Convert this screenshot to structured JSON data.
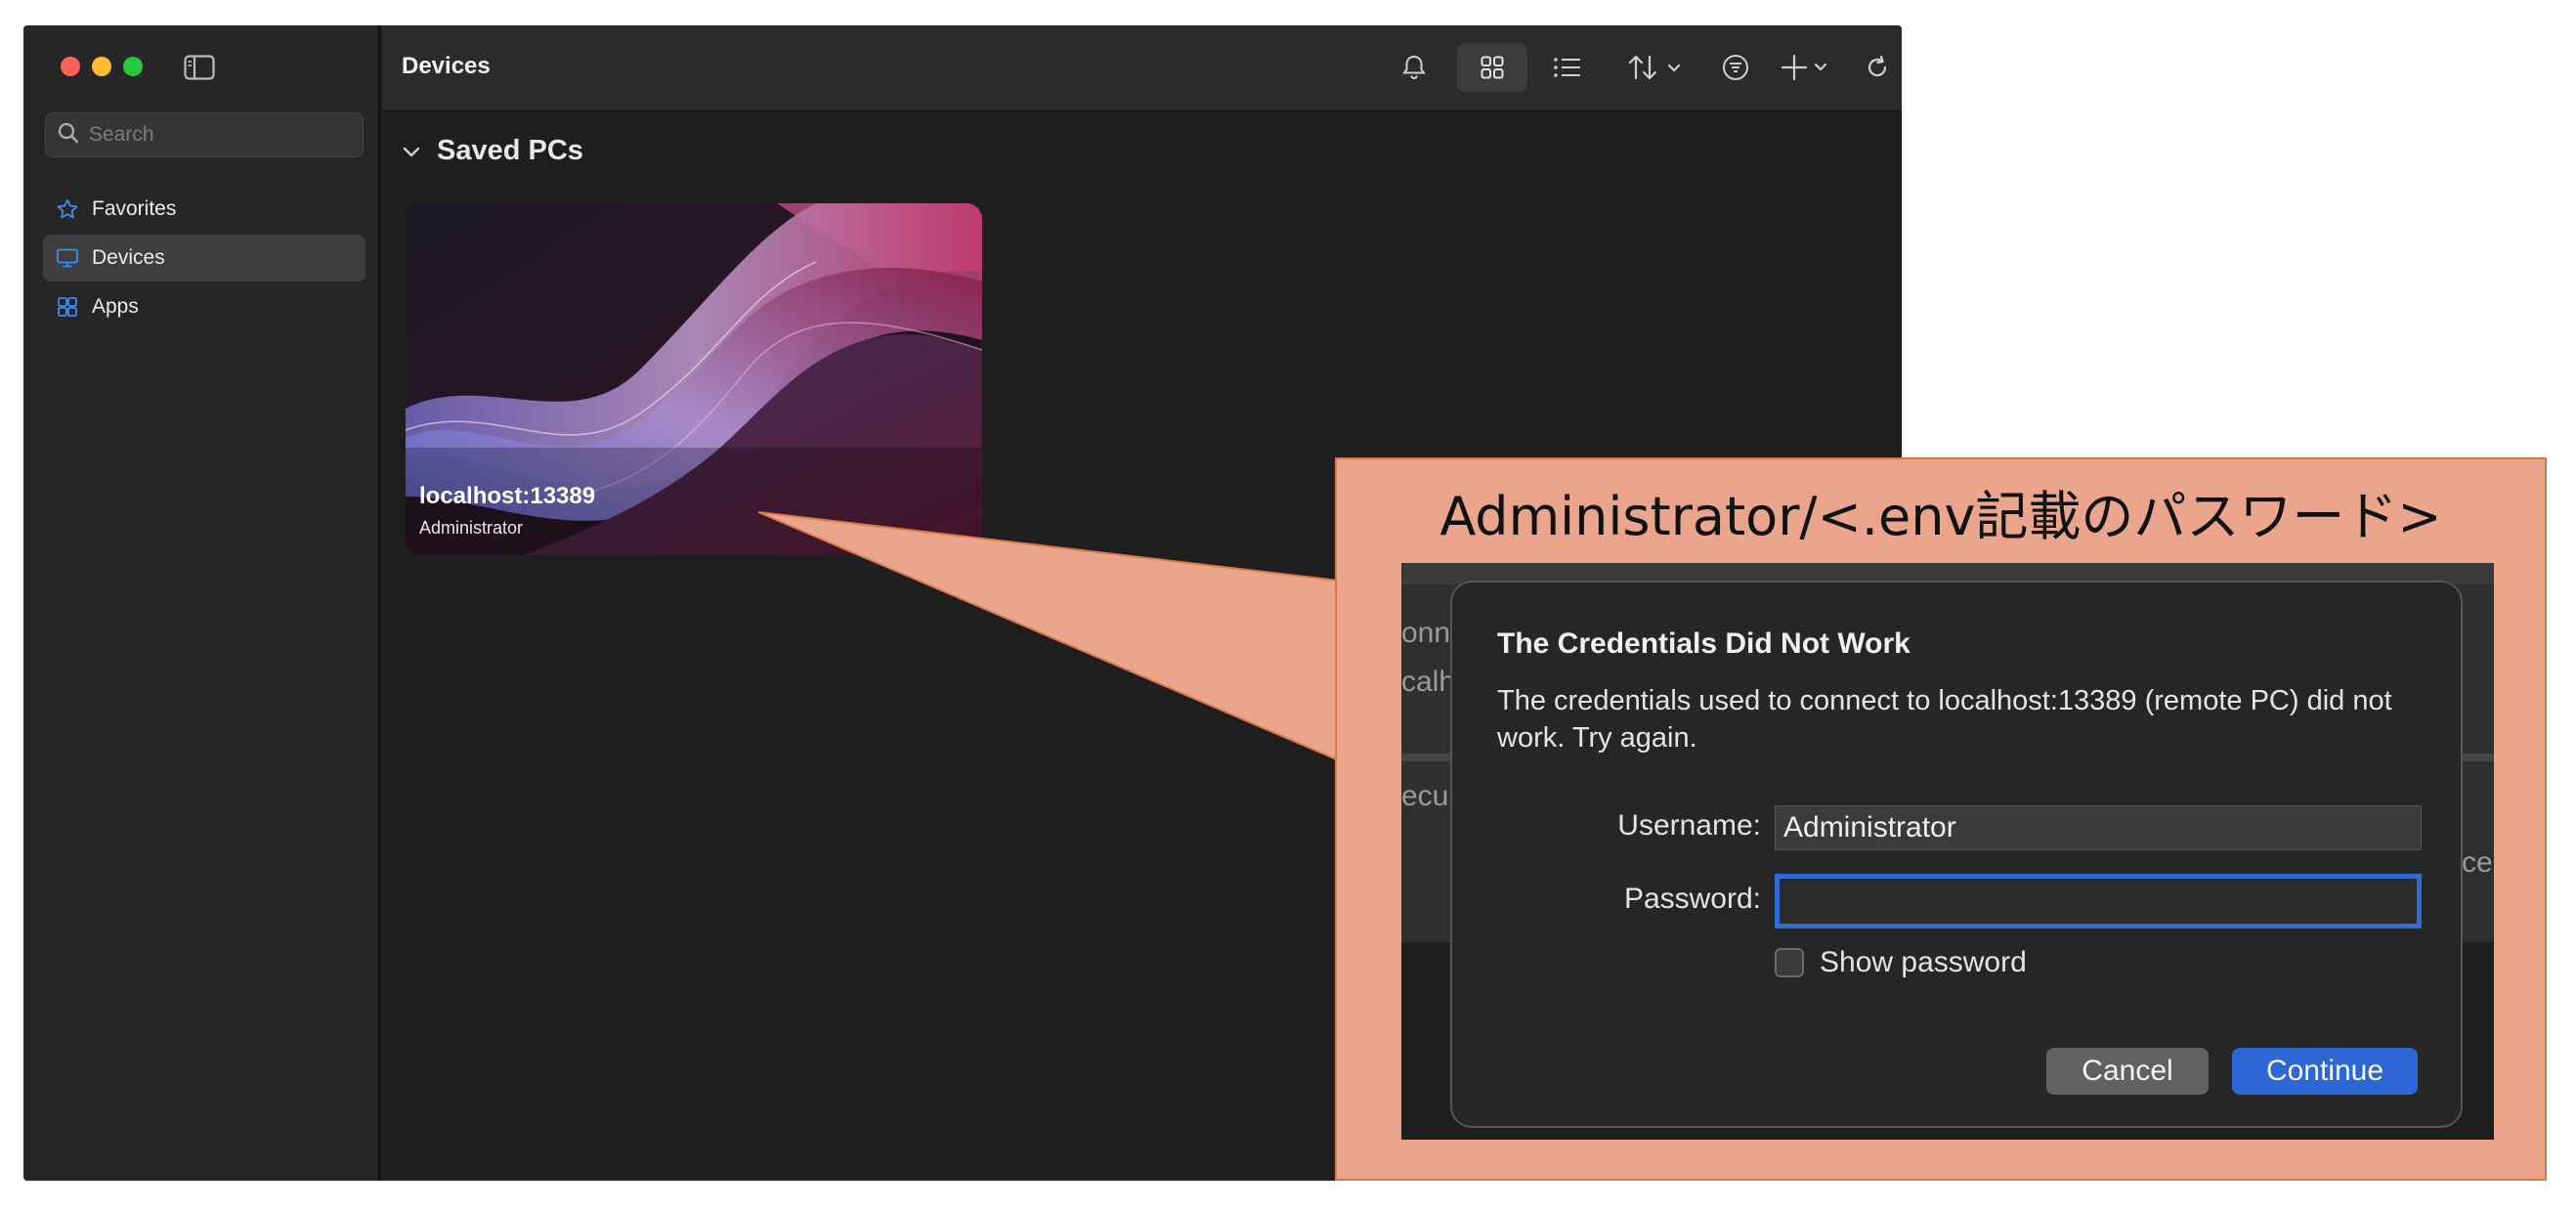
{
  "window": {
    "title": "Devices",
    "search_placeholder": "Search"
  },
  "sidebar": {
    "items": [
      {
        "label": "Favorites",
        "icon": "star-icon"
      },
      {
        "label": "Devices",
        "icon": "monitor-icon",
        "active": true
      },
      {
        "label": "Apps",
        "icon": "apps-grid-icon"
      }
    ]
  },
  "toolbar": {
    "icons": [
      "bell-icon",
      "grid-view-icon",
      "list-view-icon",
      "sort-icon",
      "filter-icon",
      "add-icon",
      "refresh-icon"
    ]
  },
  "section": {
    "title": "Saved PCs"
  },
  "pc_card": {
    "name": "localhost:13389",
    "user": "Administrator"
  },
  "callout": {
    "text": "Administrator/<.env記載のパスワード>",
    "fragments": [
      "onn",
      "calh",
      "ecu",
      "ce"
    ]
  },
  "dialog": {
    "title": "The Credentials Did Not Work",
    "message": "The credentials used to connect to localhost:13389 (remote PC) did not work. Try again.",
    "username_label": "Username:",
    "username_value": "Administrator",
    "password_label": "Password:",
    "password_value": "",
    "show_password_label": "Show password",
    "cancel_label": "Cancel",
    "continue_label": "Continue"
  },
  "colors": {
    "accent": "#2d67d5",
    "callout_fill": "#eaa58c",
    "callout_border": "#d77848"
  }
}
